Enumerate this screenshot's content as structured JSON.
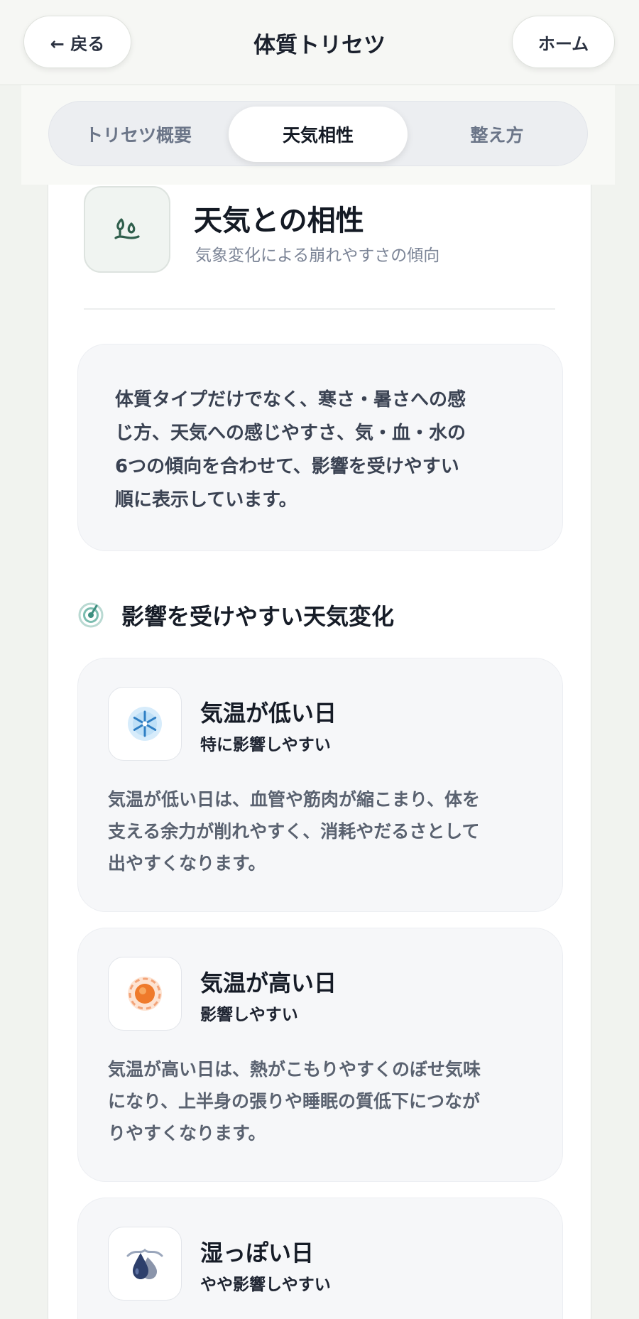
{
  "header": {
    "back_label": "← 戻る",
    "title": "体質トリセツ",
    "home_label": "ホーム"
  },
  "tabs": [
    {
      "label": "トリセツ概要",
      "active": false
    },
    {
      "label": "天気相性",
      "active": true
    },
    {
      "label": "整え方",
      "active": false
    }
  ],
  "section": {
    "icon": "weather-sprout-icon",
    "title": "天気との相性",
    "subtitle": "気象変化による崩れやすさの傾向",
    "note_lines": [
      "体質タイプだけでなく、寒さ・暑さへの感",
      "じ方、天気への感じやすさ、気・血・水の",
      "6つの傾向を合わせて、影響を受けやすい",
      "順に表示しています。"
    ]
  },
  "list": {
    "icon": "radar-icon",
    "heading": "影響を受けやすい天気変化",
    "items": [
      {
        "icon": "snowflake-icon",
        "title": "気温が低い日",
        "level": "特に影響しやすい",
        "desc_lines": [
          "気温が低い日は、血管や筋肉が縮こまり、体を",
          "支える余力が削れやすく、消耗やだるさとして",
          "出やすくなります。"
        ]
      },
      {
        "icon": "sun-icon",
        "title": "気温が高い日",
        "level": "影響しやすい",
        "desc_lines": [
          "気温が高い日は、熱がこもりやすくのぼせ気味",
          "になり、上半身の張りや睡眠の質低下につなが",
          "りやすくなります。"
        ]
      },
      {
        "icon": "humid-drop-icon",
        "title": "湿っぽい日",
        "level": "やや影響しやすい",
        "desc_lines": []
      }
    ]
  },
  "colors": {
    "background": "#f1f3ef",
    "card": "#ffffff",
    "accent_green": "#2f5e4c",
    "text_dark": "#161c27",
    "text_muted": "#7b8496"
  }
}
